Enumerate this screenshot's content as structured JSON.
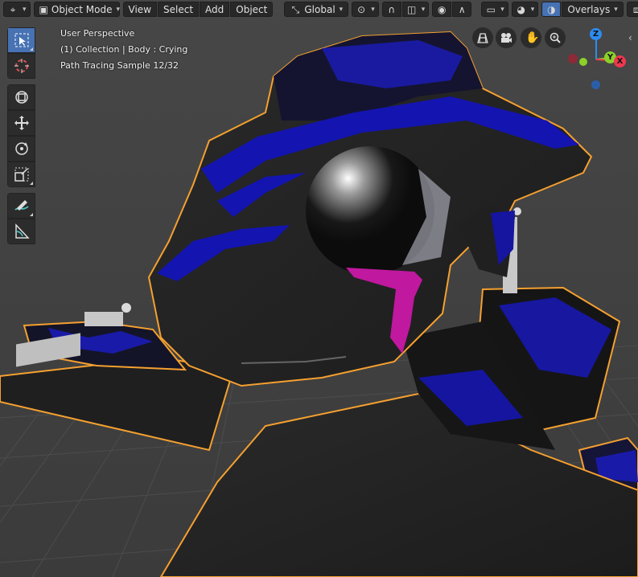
{
  "header": {
    "editor_type_icon": "editor-type-icon",
    "mode": "Object Mode",
    "menus": [
      "View",
      "Select",
      "Add",
      "Object"
    ],
    "transform_orientation": "Global",
    "overlays_label": "Overlays"
  },
  "viewport_info": {
    "perspective": "User Perspective",
    "collection": "(1) Collection | Body : Crying",
    "render_status": "Path Tracing Sample 12/32"
  },
  "toolbar": {
    "tools": [
      "select-box-icon",
      "cursor-icon",
      "move-icon",
      "move-icon",
      "rotate-icon",
      "scale-icon",
      "annotate-icon",
      "measure-icon"
    ]
  },
  "gizmo": {
    "z_label": "Z",
    "y_label": "Y",
    "x_label": "X",
    "colors": {
      "x": "#f0374f",
      "y": "#8bd129",
      "z": "#2c8cf0"
    }
  },
  "colors": {
    "selection_outline": "#f5a030",
    "active_tool": "#4772b3",
    "tear": "#c0189e",
    "fur_blue": "#1414a0"
  }
}
